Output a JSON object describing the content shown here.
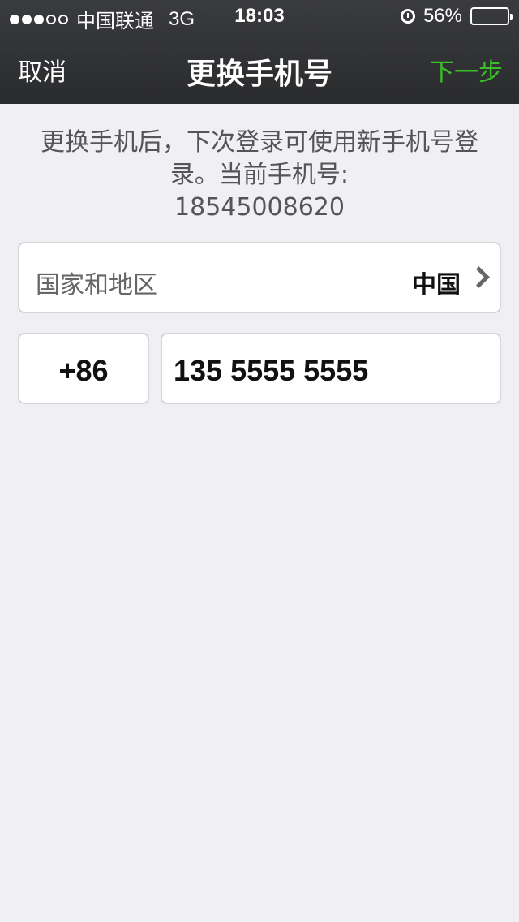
{
  "status_bar": {
    "carrier": "中国联通",
    "network": "3G",
    "time": "18:03",
    "battery": "56%",
    "signal_bars": 3,
    "battery_level": 0.56
  },
  "nav": {
    "cancel_label": "取消",
    "title": "更换手机号",
    "next_label": "下一步"
  },
  "description": {
    "line1": "更换手机后，下次登录可使用新手机号登录。当前手机号:",
    "current_number": "18545008620"
  },
  "form": {
    "region_label": "国家和地区",
    "region_value": "中国",
    "country_code": "+86",
    "phone_value": "135 5555 5555"
  },
  "colors": {
    "accent": "#3bbf28",
    "nav_bg": "#2f3032",
    "page_bg": "#efeff4"
  }
}
